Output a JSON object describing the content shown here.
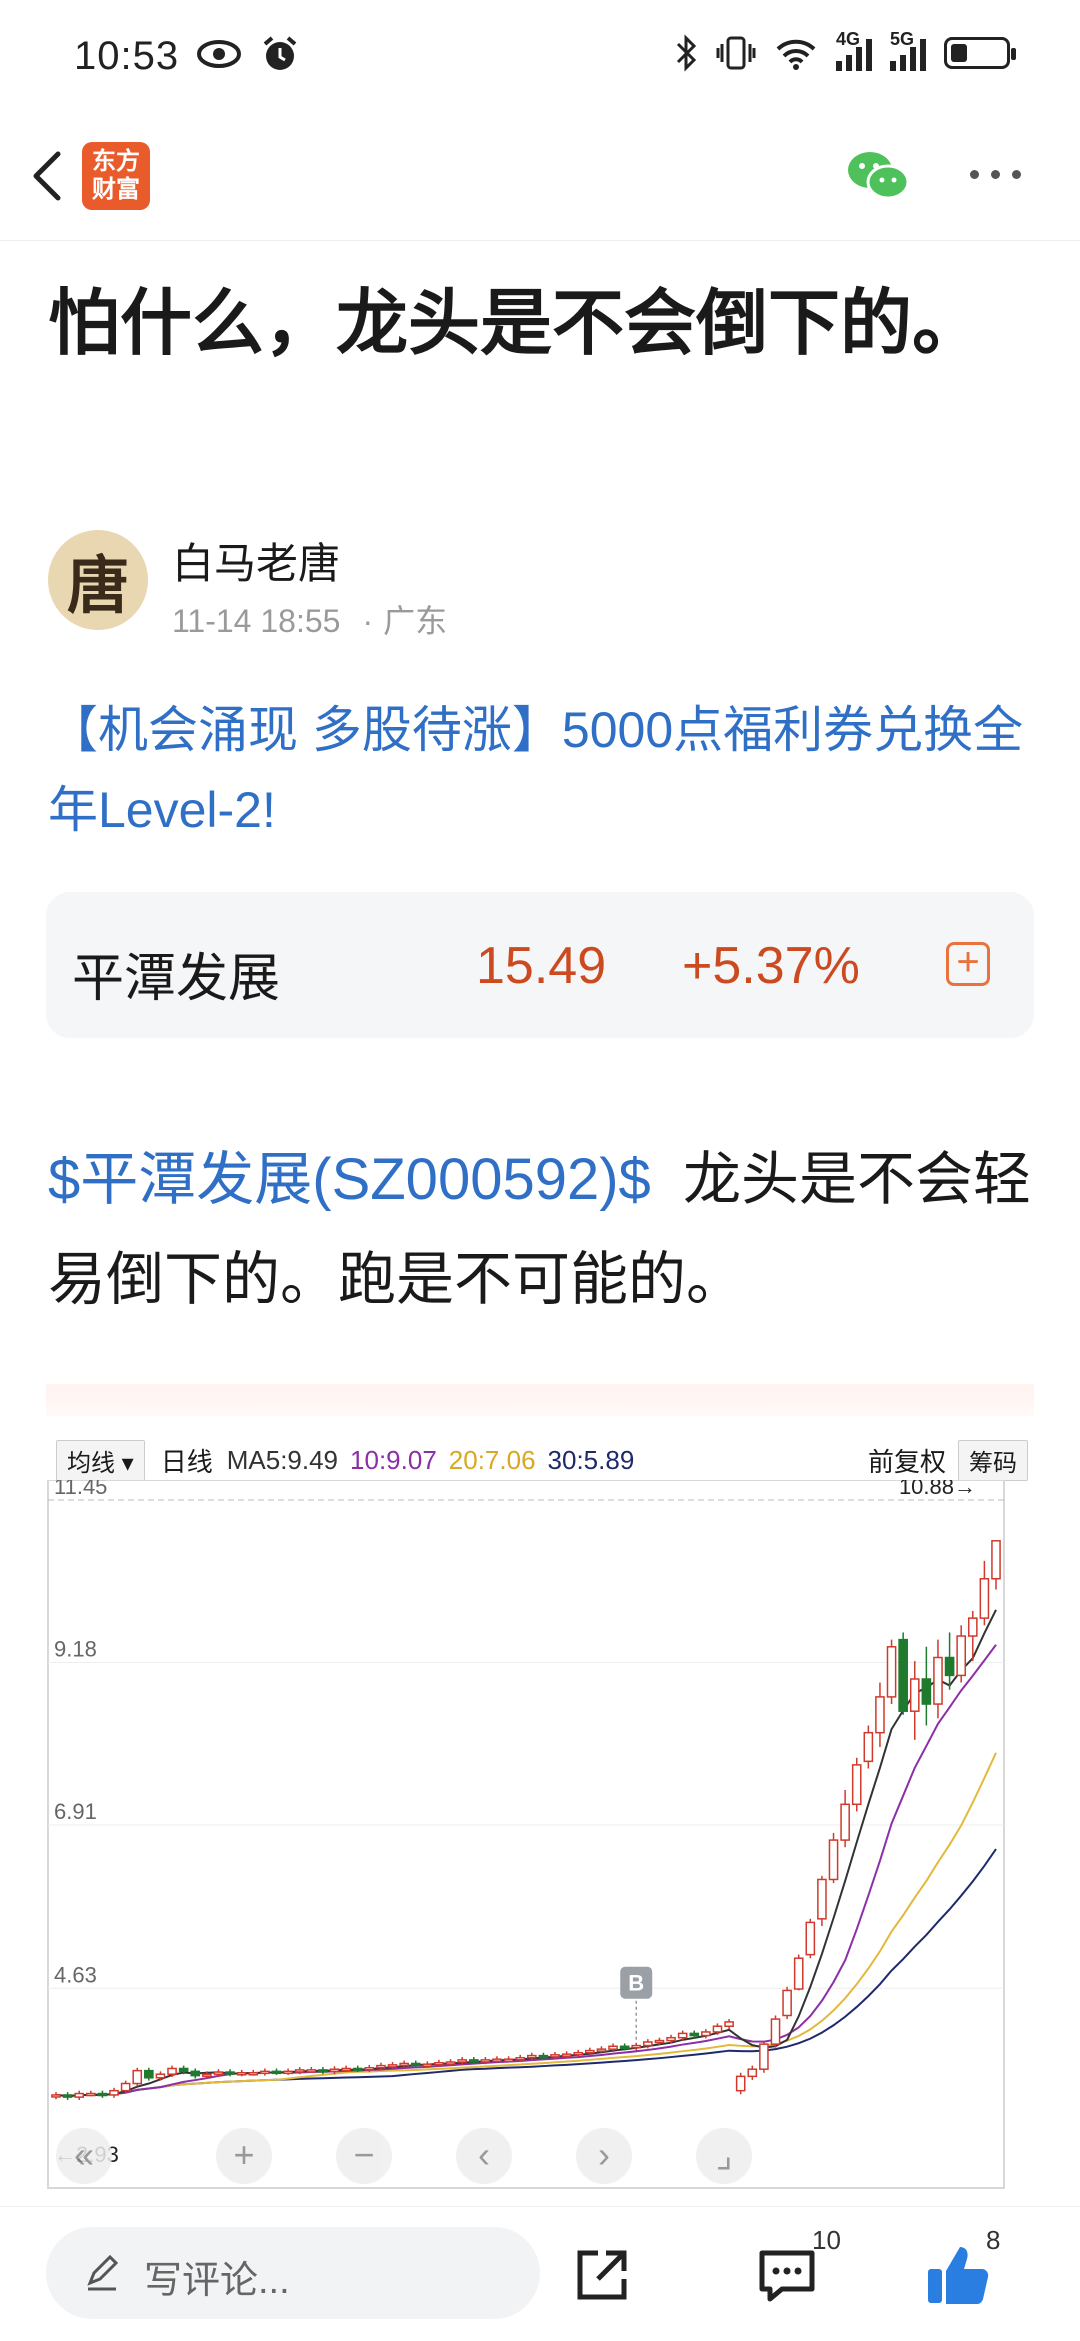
{
  "status_bar": {
    "time": "10:53",
    "network_1": "4G",
    "network_2": "5G"
  },
  "nav": {
    "logo_line1": "东方",
    "logo_line2": "财富"
  },
  "article": {
    "title": "怕什么，龙头是不会倒下的。",
    "author_avatar_char": "唐",
    "author": "白马老唐",
    "date": "11-14 18:55",
    "location": "广东",
    "promo": "【机会涌现 多股待涨】5000点福利券兑换全年Level-2!",
    "body_cashtag": "$平潭发展(SZ000592)$",
    "body_text": "龙头是不会轻易倒下的。跑是不可能的。"
  },
  "stock_card": {
    "name": "平潭发展",
    "price": "15.49",
    "change": "+5.37%"
  },
  "chart_header": {
    "mode": "均线",
    "period": "日线",
    "ma5": "MA5:9.49",
    "ma10": "10:9.07",
    "ma20": "20:7.06",
    "ma30": "30:5.89",
    "adjust": "前复权",
    "chips": "筹码"
  },
  "chart_data": {
    "type": "candlestick",
    "y_ticks": [
      "11.45",
      "9.18",
      "6.91",
      "4.63"
    ],
    "y_values": [
      11.45,
      9.18,
      6.91,
      4.63
    ],
    "ylim": [
      2.93,
      11.45
    ],
    "high_label": "10.88→",
    "low_label": "←2.93",
    "buy_marker": "B",
    "colors": {
      "up": "#d0392b",
      "down": "#1f7a2e",
      "ma5": "#333333",
      "ma10": "#8b2fa8",
      "ma20": "#e2b93b",
      "ma30": "#1f2a6b"
    },
    "candles_tail": [
      {
        "o": 3.2,
        "h": 3.45,
        "l": 3.15,
        "c": 3.4
      },
      {
        "o": 3.4,
        "h": 3.55,
        "l": 3.35,
        "c": 3.5
      },
      {
        "o": 3.5,
        "h": 3.9,
        "l": 3.45,
        "c": 3.85
      },
      {
        "o": 3.85,
        "h": 4.25,
        "l": 3.8,
        "c": 4.2
      },
      {
        "o": 4.25,
        "h": 4.65,
        "l": 4.2,
        "c": 4.6
      },
      {
        "o": 4.62,
        "h": 5.1,
        "l": 4.6,
        "c": 5.05
      },
      {
        "o": 5.1,
        "h": 5.6,
        "l": 5.05,
        "c": 5.55
      },
      {
        "o": 5.6,
        "h": 6.2,
        "l": 5.5,
        "c": 6.15
      },
      {
        "o": 6.15,
        "h": 6.8,
        "l": 6.1,
        "c": 6.7
      },
      {
        "o": 6.7,
        "h": 7.4,
        "l": 6.6,
        "c": 7.2
      },
      {
        "o": 7.2,
        "h": 7.85,
        "l": 7.1,
        "c": 7.75
      },
      {
        "o": 7.8,
        "h": 8.3,
        "l": 7.7,
        "c": 8.2
      },
      {
        "o": 8.2,
        "h": 8.9,
        "l": 8.0,
        "c": 8.7
      },
      {
        "o": 8.7,
        "h": 9.5,
        "l": 8.6,
        "c": 9.4
      },
      {
        "o": 9.5,
        "h": 9.6,
        "l": 8.45,
        "c": 8.5
      },
      {
        "o": 8.5,
        "h": 9.2,
        "l": 8.1,
        "c": 8.95
      },
      {
        "o": 8.95,
        "h": 9.4,
        "l": 8.3,
        "c": 8.6
      },
      {
        "o": 8.6,
        "h": 9.5,
        "l": 8.4,
        "c": 9.25
      },
      {
        "o": 9.25,
        "h": 9.6,
        "l": 8.8,
        "c": 9.0
      },
      {
        "o": 9.0,
        "h": 9.7,
        "l": 8.9,
        "c": 9.55
      },
      {
        "o": 9.55,
        "h": 9.9,
        "l": 9.2,
        "c": 9.8
      },
      {
        "o": 9.8,
        "h": 10.6,
        "l": 9.7,
        "c": 10.35
      },
      {
        "o": 10.35,
        "h": 10.88,
        "l": 10.2,
        "c": 10.88
      }
    ]
  },
  "bottom_bar": {
    "comment_placeholder": "写评论...",
    "comment_count": "10",
    "like_count": "8"
  }
}
